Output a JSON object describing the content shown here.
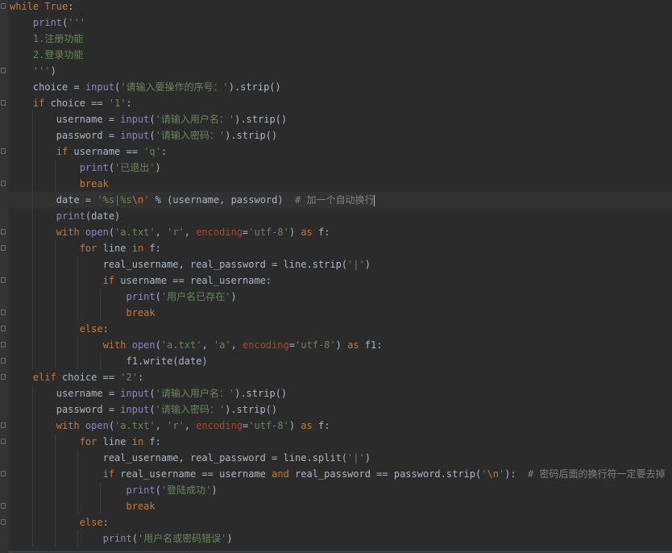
{
  "editor": {
    "language": "python",
    "line_height": 20,
    "current_line_index": 12,
    "colors": {
      "background": "#2b2b2b",
      "keyword": "#cc7832",
      "builtin": "#8888c6",
      "string": "#6a8759",
      "number": "#6897bb",
      "param": "#aa4926",
      "comment": "#808080",
      "text": "#a9b7c6"
    },
    "lines": [
      {
        "fold": true,
        "tokens": [
          [
            "kw",
            "while "
          ],
          [
            "kw",
            "True"
          ],
          [
            "tx",
            ":"
          ]
        ]
      },
      {
        "fold": false,
        "tokens": [
          [
            "tx",
            "    "
          ],
          [
            "fn",
            "print"
          ],
          [
            "tx",
            "("
          ],
          [
            "str",
            "'''"
          ]
        ]
      },
      {
        "fold": false,
        "tokens": [
          [
            "str",
            "    1.注册功能"
          ]
        ]
      },
      {
        "fold": false,
        "tokens": [
          [
            "str",
            "    2.登录功能"
          ]
        ]
      },
      {
        "fold": true,
        "tokens": [
          [
            "str",
            "    '''"
          ],
          [
            "tx",
            ")"
          ]
        ]
      },
      {
        "fold": false,
        "tokens": [
          [
            "tx",
            "    choice = "
          ],
          [
            "fn",
            "input"
          ],
          [
            "tx",
            "("
          ],
          [
            "str",
            "'请输入要操作的序号：'"
          ],
          [
            "tx",
            ").strip()"
          ]
        ]
      },
      {
        "fold": true,
        "tokens": [
          [
            "tx",
            "    "
          ],
          [
            "kw",
            "if "
          ],
          [
            "tx",
            "choice == "
          ],
          [
            "str",
            "'1'"
          ],
          [
            "tx",
            ":"
          ]
        ]
      },
      {
        "fold": false,
        "tokens": [
          [
            "tx",
            "        username = "
          ],
          [
            "fn",
            "input"
          ],
          [
            "tx",
            "("
          ],
          [
            "str",
            "'请输入用户名：'"
          ],
          [
            "tx",
            ").strip()"
          ]
        ]
      },
      {
        "fold": false,
        "tokens": [
          [
            "tx",
            "        password = "
          ],
          [
            "fn",
            "input"
          ],
          [
            "tx",
            "("
          ],
          [
            "str",
            "'请输入密码：'"
          ],
          [
            "tx",
            ").strip()"
          ]
        ]
      },
      {
        "fold": true,
        "tokens": [
          [
            "tx",
            "        "
          ],
          [
            "kw",
            "if "
          ],
          [
            "tx",
            "username == "
          ],
          [
            "str",
            "'q'"
          ],
          [
            "tx",
            ":"
          ]
        ]
      },
      {
        "fold": false,
        "tokens": [
          [
            "tx",
            "            "
          ],
          [
            "fn",
            "print"
          ],
          [
            "tx",
            "("
          ],
          [
            "str",
            "'已退出'"
          ],
          [
            "tx",
            ")"
          ]
        ]
      },
      {
        "fold": true,
        "tokens": [
          [
            "tx",
            "            "
          ],
          [
            "kw",
            "break"
          ]
        ]
      },
      {
        "fold": false,
        "tokens": [
          [
            "tx",
            "        date = "
          ],
          [
            "str",
            "'%s|%s"
          ],
          [
            "esc",
            "\\n"
          ],
          [
            "str",
            "'"
          ],
          [
            "tx",
            " % (username, password)  "
          ],
          [
            "cmt",
            "# 加一个自动换行"
          ]
        ]
      },
      {
        "fold": false,
        "tokens": [
          [
            "tx",
            "        "
          ],
          [
            "fn",
            "print"
          ],
          [
            "tx",
            "(date)"
          ]
        ]
      },
      {
        "fold": true,
        "tokens": [
          [
            "tx",
            "        "
          ],
          [
            "kw",
            "with "
          ],
          [
            "fn",
            "open"
          ],
          [
            "tx",
            "("
          ],
          [
            "str",
            "'a.txt'"
          ],
          [
            "tx",
            ", "
          ],
          [
            "str",
            "'r'"
          ],
          [
            "tx",
            ", "
          ],
          [
            "param",
            "encoding"
          ],
          [
            "tx",
            "="
          ],
          [
            "str",
            "'utf-8'"
          ],
          [
            "tx",
            ") "
          ],
          [
            "kw",
            "as "
          ],
          [
            "tx",
            "f:"
          ]
        ]
      },
      {
        "fold": true,
        "tokens": [
          [
            "tx",
            "            "
          ],
          [
            "kw",
            "for "
          ],
          [
            "tx",
            "line "
          ],
          [
            "kw",
            "in "
          ],
          [
            "tx",
            "f:"
          ]
        ]
      },
      {
        "fold": false,
        "tokens": [
          [
            "tx",
            "                real_username, real_password = line.strip("
          ],
          [
            "str",
            "'|'"
          ],
          [
            "tx",
            ")"
          ]
        ]
      },
      {
        "fold": true,
        "tokens": [
          [
            "tx",
            "                "
          ],
          [
            "kw",
            "if "
          ],
          [
            "tx",
            "username == real_username:"
          ]
        ]
      },
      {
        "fold": false,
        "tokens": [
          [
            "tx",
            "                    "
          ],
          [
            "fn",
            "print"
          ],
          [
            "tx",
            "("
          ],
          [
            "str",
            "'用户名已存在'"
          ],
          [
            "tx",
            ")"
          ]
        ]
      },
      {
        "fold": true,
        "tokens": [
          [
            "tx",
            "                    "
          ],
          [
            "kw",
            "break"
          ]
        ]
      },
      {
        "fold": true,
        "tokens": [
          [
            "tx",
            "            "
          ],
          [
            "kw",
            "else"
          ],
          [
            "tx",
            ":"
          ]
        ]
      },
      {
        "fold": true,
        "tokens": [
          [
            "tx",
            "                "
          ],
          [
            "kw",
            "with "
          ],
          [
            "fn",
            "open"
          ],
          [
            "tx",
            "("
          ],
          [
            "str",
            "'a.txt'"
          ],
          [
            "tx",
            ", "
          ],
          [
            "str",
            "'a'"
          ],
          [
            "tx",
            ", "
          ],
          [
            "param",
            "encoding"
          ],
          [
            "tx",
            "="
          ],
          [
            "str",
            "'utf-8'"
          ],
          [
            "tx",
            ") "
          ],
          [
            "kw",
            "as "
          ],
          [
            "tx",
            "f1:"
          ]
        ]
      },
      {
        "fold": true,
        "tokens": [
          [
            "tx",
            "                    f1.write(date)"
          ]
        ]
      },
      {
        "fold": true,
        "tokens": [
          [
            "tx",
            "    "
          ],
          [
            "kw",
            "elif "
          ],
          [
            "tx",
            "choice == "
          ],
          [
            "str",
            "'2'"
          ],
          [
            "tx",
            ":"
          ]
        ]
      },
      {
        "fold": false,
        "tokens": [
          [
            "tx",
            "        username = "
          ],
          [
            "fn",
            "input"
          ],
          [
            "tx",
            "("
          ],
          [
            "str",
            "'请输入用户名：'"
          ],
          [
            "tx",
            ").strip()"
          ]
        ]
      },
      {
        "fold": false,
        "tokens": [
          [
            "tx",
            "        password = "
          ],
          [
            "fn",
            "input"
          ],
          [
            "tx",
            "("
          ],
          [
            "str",
            "'请输入密码：'"
          ],
          [
            "tx",
            ").strip()"
          ]
        ]
      },
      {
        "fold": true,
        "tokens": [
          [
            "tx",
            "        "
          ],
          [
            "kw",
            "with "
          ],
          [
            "fn",
            "open"
          ],
          [
            "tx",
            "("
          ],
          [
            "str",
            "'a.txt'"
          ],
          [
            "tx",
            ", "
          ],
          [
            "str",
            "'r'"
          ],
          [
            "tx",
            ", "
          ],
          [
            "param",
            "encoding"
          ],
          [
            "tx",
            "="
          ],
          [
            "str",
            "'utf-8'"
          ],
          [
            "tx",
            ") "
          ],
          [
            "kw",
            "as "
          ],
          [
            "tx",
            "f:"
          ]
        ]
      },
      {
        "fold": true,
        "tokens": [
          [
            "tx",
            "            "
          ],
          [
            "kw",
            "for "
          ],
          [
            "tx",
            "line "
          ],
          [
            "kw",
            "in "
          ],
          [
            "tx",
            "f:"
          ]
        ]
      },
      {
        "fold": false,
        "tokens": [
          [
            "tx",
            "                real_username, real_password = line.split("
          ],
          [
            "str",
            "'|'"
          ],
          [
            "tx",
            ")"
          ]
        ]
      },
      {
        "fold": true,
        "tokens": [
          [
            "tx",
            "                "
          ],
          [
            "kw",
            "if "
          ],
          [
            "tx",
            "real_username == username "
          ],
          [
            "kw",
            "and "
          ],
          [
            "tx",
            "real_password == password.strip("
          ],
          [
            "str",
            "'"
          ],
          [
            "esc",
            "\\n"
          ],
          [
            "str",
            "'"
          ],
          [
            "tx",
            "):  "
          ],
          [
            "cmt",
            "# 密码后面的换行符一定要去掉"
          ]
        ]
      },
      {
        "fold": false,
        "tokens": [
          [
            "tx",
            "                    "
          ],
          [
            "fn",
            "print"
          ],
          [
            "tx",
            "("
          ],
          [
            "str",
            "'登陆成功'"
          ],
          [
            "tx",
            ")"
          ]
        ]
      },
      {
        "fold": true,
        "tokens": [
          [
            "tx",
            "                    "
          ],
          [
            "kw",
            "break"
          ]
        ]
      },
      {
        "fold": true,
        "tokens": [
          [
            "tx",
            "            "
          ],
          [
            "kw",
            "else"
          ],
          [
            "tx",
            ":"
          ]
        ]
      },
      {
        "fold": false,
        "tokens": [
          [
            "tx",
            "                "
          ],
          [
            "fn",
            "print"
          ],
          [
            "tx",
            "("
          ],
          [
            "str",
            "'用户名或密码错误'"
          ],
          [
            "tx",
            ")"
          ]
        ]
      }
    ]
  }
}
